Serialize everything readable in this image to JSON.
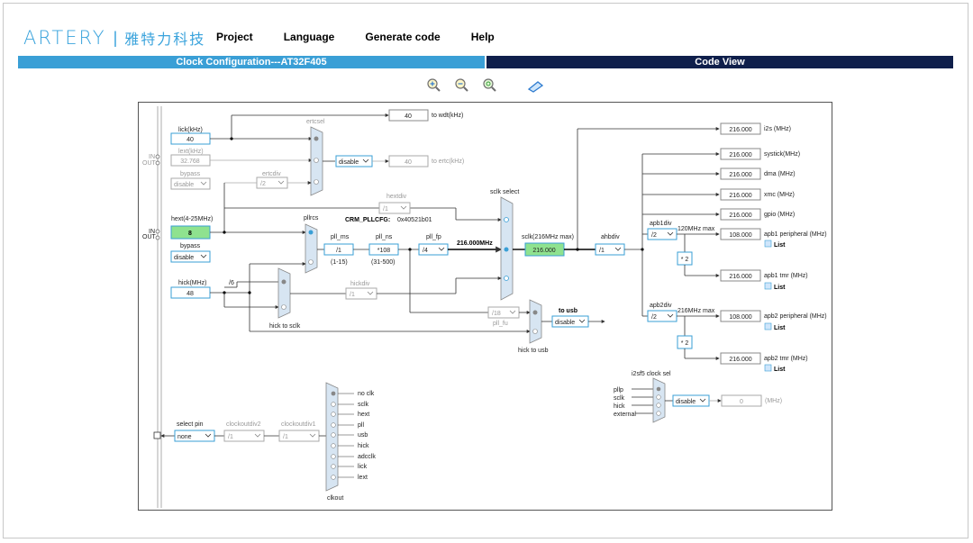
{
  "brand": {
    "name": "ARTERY",
    "cn": "雅特力科技"
  },
  "menu": {
    "project": "Project",
    "language": "Language",
    "generate": "Generate code",
    "help": "Help"
  },
  "tabs": {
    "left": "Clock Configuration---AT32F405",
    "right": "Code View"
  },
  "toolbar": {
    "zoom_in": "zoom-in-icon",
    "zoom_out": "zoom-out-icon",
    "zoom_fit": "zoom-fit-icon",
    "reset": "reset-icon"
  },
  "diagram": {
    "lick_label": "lick(kHz)",
    "lick_val": "40",
    "lext_label": "lext(kHz)",
    "lext_val": "32.768",
    "bypass_label": "bypass",
    "bypass_val": "disable",
    "in_label": "IN",
    "out_label": "OUT",
    "ertcsel": "ertcsel",
    "ertcsel_val": "disable",
    "ertcdiv": "ertcdiv",
    "ertcdiv_val": "/2",
    "to_wdt_val": "40",
    "to_wdt": "to wdt(kHz)",
    "to_ertc_val": "40",
    "to_ertc": "to ertc(kHz)",
    "hext_label": "hext(4-25MHz)",
    "hext_val": "8",
    "hext_bypass": "bypass",
    "hext_bypass_val": "disable",
    "hextdiv": "hextdiv",
    "hextdiv_val": "/1",
    "crm_pllcfg": "CRM_PLLCFG:",
    "crm_pllcfg_val": "0x40521b01",
    "pllrcs": "pllrcs",
    "pll_ms": "pll_ms",
    "pll_ms_val": "/1",
    "pll_ms_range": "(1-15)",
    "pll_ns": "pll_ns",
    "pll_ns_val": "*108",
    "pll_ns_range": "(31-500)",
    "pll_fp": "pll_fp",
    "pll_fp_val": "/4",
    "pll_out": "216.000MHz",
    "sclk_select": "sclk select",
    "sclk_label": "sclk(216MHz max)",
    "sclk_val": "216.000",
    "ahbdiv": "ahbdiv",
    "ahbdiv_val": "/1",
    "hick_label": "hick(MHz)",
    "hick_val": "48",
    "hick_div6": "/6",
    "hickdiv": "hickdiv",
    "hickdiv_val": "/1",
    "hick_to_sclk": "hick to sclk",
    "pll_fu_val": "/18",
    "pll_fu": "pll_fu",
    "to_usb": "to usb",
    "to_usb_val": "disable",
    "hick_to_usb": "hick to usb",
    "i2s_val": "216.000",
    "i2s": "i2s (MHz)",
    "systick_val": "216.000",
    "systick": "systick(MHz)",
    "dma_val": "216.000",
    "dma": "dma (MHz)",
    "xmc_val": "216.000",
    "xmc": "xmc (MHz)",
    "gpio_val": "216.000",
    "gpio": "gpio (MHz)",
    "apb1div": "apb1div",
    "apb1div_val": "/2",
    "apb1_max": "120MHz  max",
    "apb1p_val": "108.000",
    "apb1p": "apb1 peripheral (MHz)",
    "apb1_mul": "* 2",
    "apb1t_val": "216.000",
    "apb1t": "apb1 tmr (MHz)",
    "apb2div": "apb2div",
    "apb2div_val": "/2",
    "apb2_max": "216MHz  max",
    "apb2p_val": "108.000",
    "apb2p": "apb2 peripheral (MHz)",
    "apb2_mul": "* 2",
    "apb2t_val": "216.000",
    "apb2t": "apb2 tmr (MHz)",
    "list": "List",
    "i2sf5": "i2sf5 clock sel",
    "i2sf5_inputs": [
      "pllp",
      "sclk",
      "hick",
      "external"
    ],
    "i2sf5_sel": "disable",
    "i2sf5_out": "0",
    "i2sf5_unit": "(MHz)",
    "select_pin": "select pin",
    "select_pin_val": "none",
    "clockoutdiv2": "clockoutdiv2",
    "clockoutdiv2_val": "/1",
    "clockoutdiv1": "clockoutdiv1",
    "clockoutdiv1_val": "/1",
    "clkout_items": [
      "no clk",
      "sclk",
      "hext",
      "pll",
      "usb",
      "hick",
      "adcclk",
      "lick",
      "lext"
    ],
    "clkout": "clkout"
  },
  "colors": {
    "accent": "#3a9fd6",
    "navy": "#0f1f4b",
    "green": "#8fe28f",
    "value": "#2e8b2e",
    "box": "#3a9fd6"
  }
}
